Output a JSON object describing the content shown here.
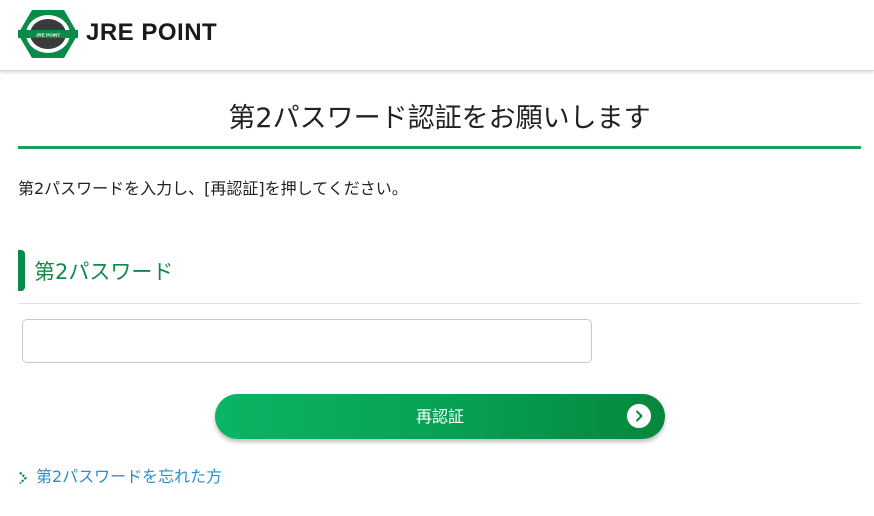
{
  "header": {
    "brand_name": "JRE POINT",
    "logo_text": "JRE POINT"
  },
  "main": {
    "title": "第2パスワード認証をお願いします",
    "instruction": "第2パスワードを入力し、[再認証]を押してください。",
    "section_heading": "第2パスワード",
    "password_field": {
      "value": "",
      "placeholder": ""
    },
    "reauth_button_label": "再認証",
    "forgot_link_text": "第2パスワードを忘れた方"
  },
  "icons": {
    "logo": "jre-point-logo",
    "button_arrow": "chevron-right-circle-icon",
    "link_arrow": "chevron-right-icon"
  },
  "colors": {
    "brand_green": "#0a8a48",
    "title_rule": "#16a35d",
    "button_gradient_start": "#0bb565",
    "button_gradient_end": "#06863e",
    "link_blue": "#2a8fcf"
  }
}
